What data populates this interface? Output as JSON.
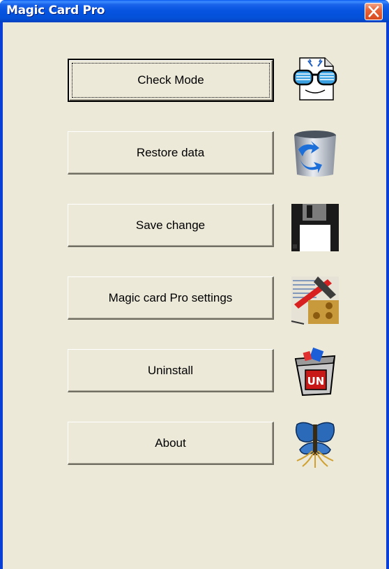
{
  "window": {
    "title": "Magic Card Pro"
  },
  "buttons": [
    {
      "label": "Check Mode",
      "icon": "glasses-document-icon"
    },
    {
      "label": "Restore data",
      "icon": "restore-bin-icon"
    },
    {
      "label": "Save change",
      "icon": "floppy-disk-icon"
    },
    {
      "label": "Magic card Pro settings",
      "icon": "settings-tools-icon"
    },
    {
      "label": "Uninstall",
      "icon": "uninstall-trash-icon"
    },
    {
      "label": "About",
      "icon": "butterfly-icon"
    }
  ],
  "colors": {
    "titlebar": "#0553e0",
    "client_bg": "#ece9d8",
    "close_button": "#e6643a"
  }
}
